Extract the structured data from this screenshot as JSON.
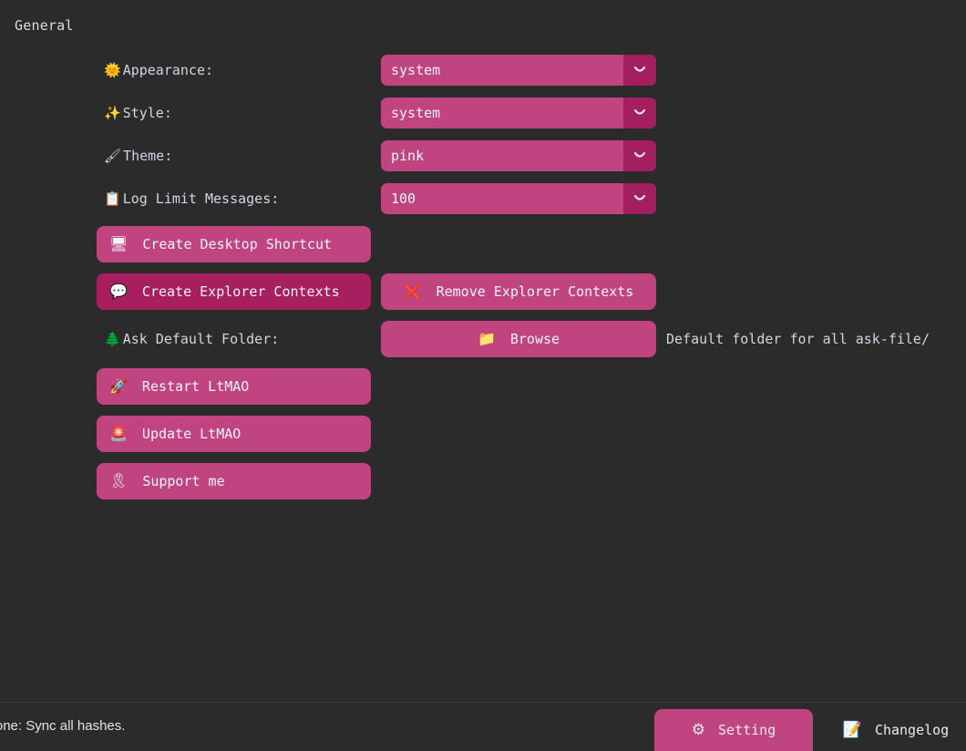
{
  "section": {
    "title": "General"
  },
  "fields": [
    {
      "icon": "sun-icon",
      "glyph": "🌞",
      "label": "Appearance:",
      "value": "system",
      "control": "dropdown"
    },
    {
      "icon": "sparkles-icon",
      "glyph": "✨",
      "label": "Style:",
      "value": "system",
      "control": "dropdown"
    },
    {
      "icon": "paintbrush-icon",
      "glyph": "🖌",
      "label": "Theme:",
      "value": "pink",
      "control": "dropdown"
    },
    {
      "icon": "clipboard-icon",
      "glyph": "📋",
      "label": "Log Limit Messages:",
      "value": "100",
      "control": "dropdown"
    }
  ],
  "buttons": {
    "create_desktop_shortcut": {
      "icon": "desktop-computer-icon",
      "glyph": "🖥",
      "label": "Create Desktop Shortcut"
    },
    "create_explorer_contexts": {
      "icon": "speech-balloon-icon",
      "glyph": "💬",
      "label": "Create Explorer Contexts"
    },
    "remove_explorer_contexts": {
      "icon": "red-x-icon",
      "glyph": "❌",
      "label": "Remove Explorer Contexts"
    },
    "browse": {
      "icon": "folder-icon",
      "glyph": "📁",
      "label": "Browse"
    },
    "restart": {
      "icon": "rocket-icon",
      "glyph": "🚀",
      "label": "Restart LtMAO"
    },
    "update": {
      "icon": "siren-icon",
      "glyph": "🚨",
      "label": "Update LtMAO"
    },
    "support": {
      "icon": "ribbon-icon",
      "glyph": "🎗",
      "label": "Support me"
    }
  },
  "ask_default_folder": {
    "icon": "evergreen-tree-icon",
    "glyph": "🌲",
    "label": "Ask Default Folder:",
    "hint": "Default folder for all ask-file/"
  },
  "bottom_bar": {
    "status": "ger: Done: Sync all hashes.",
    "tabs": [
      {
        "icon": "gear-icon",
        "glyph": "⚙",
        "label": "Setting",
        "active": true
      },
      {
        "icon": "changelog-page-icon",
        "glyph": "📝",
        "label": "Changelog",
        "active": false
      }
    ]
  },
  "colors": {
    "background": "#2b2b2b",
    "accent": "#bf4480",
    "accent_dark": "#a81f5f",
    "text": "#d6dce6"
  }
}
